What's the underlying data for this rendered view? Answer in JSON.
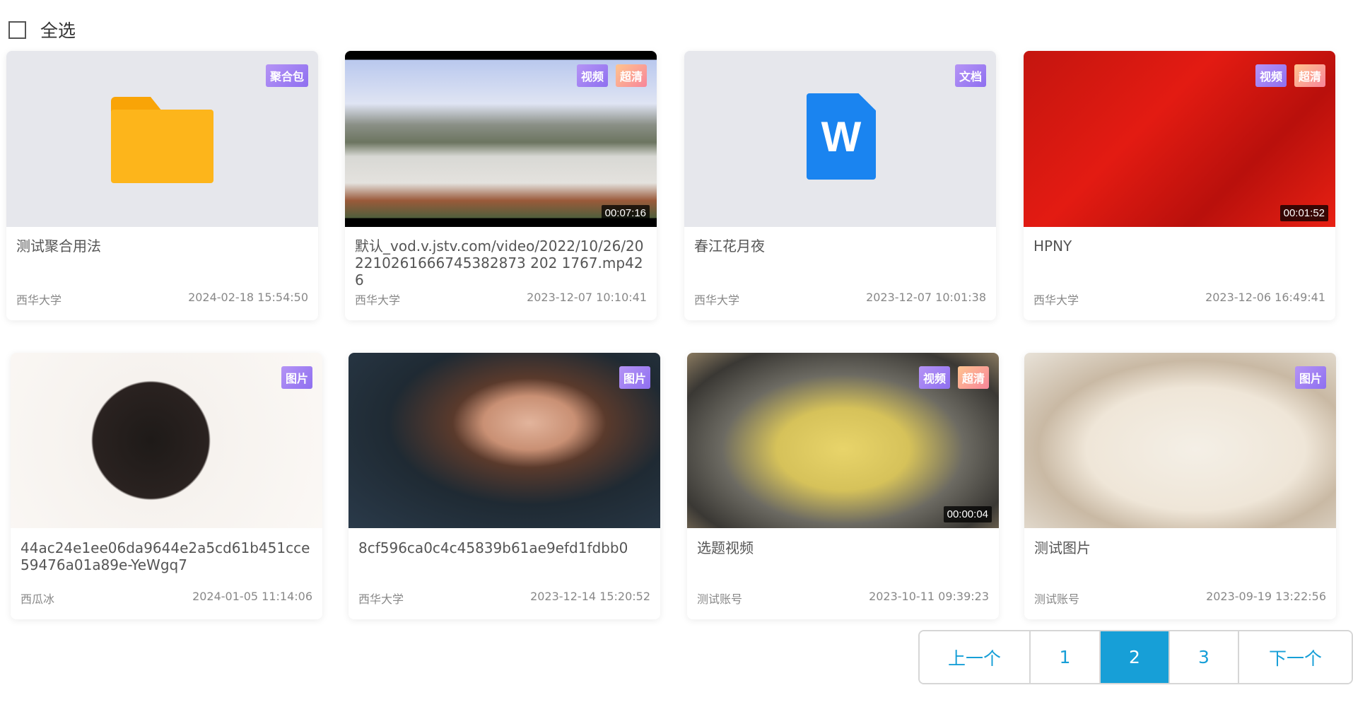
{
  "select_all": {
    "label": "全选",
    "checked": false
  },
  "cards": [
    {
      "type": "folder",
      "badges": [
        {
          "text": "聚合包",
          "color": "purple"
        }
      ],
      "duration": null,
      "title": "测试聚合用法",
      "owner": "西华大学",
      "time": "2024-02-18 15:54:50",
      "thumb": "#e6e7ec"
    },
    {
      "type": "video",
      "badges": [
        {
          "text": "视频",
          "color": "purple"
        },
        {
          "text": "超清",
          "color": "orange"
        }
      ],
      "duration": "00:07:16",
      "title": "默认_vod.v.jstv.com/video/2022/10/26/202210261666745382873 202 1767.mp426",
      "owner": "西华大学",
      "time": "2023-12-07 10:10:41",
      "thumb": "linear-gradient(180deg,#000 0,#000 5%,#b9c8ee 5%,#dfe4f3 30%,#8a8f86 42%,#6c7560 52%,#d8d8d4 60%,#e4e2de 75%,#9a5a3a 85%,#4f5f3c 95%,#000 95%)"
    },
    {
      "type": "document",
      "badges": [
        {
          "text": "文档",
          "color": "purple"
        }
      ],
      "duration": null,
      "title": "春江花月夜",
      "owner": "西华大学",
      "time": "2023-12-07 10:01:38",
      "thumb": "#e6e7ec"
    },
    {
      "type": "video",
      "badges": [
        {
          "text": "视频",
          "color": "purple"
        },
        {
          "text": "超清",
          "color": "orange"
        }
      ],
      "duration": "00:01:52",
      "title": "HPNY",
      "owner": "西华大学",
      "time": "2023-12-06 16:49:41",
      "thumb": "linear-gradient(135deg,#c4150f,#e31b12 40%,#b9100c 70%,#e82013)"
    },
    {
      "type": "image",
      "badges": [
        {
          "text": "图片",
          "color": "purple"
        }
      ],
      "duration": null,
      "title": "44ac24e1ee06da9644e2a5cd61b451cce59476a01a89e-YeWgq7",
      "owner": "西瓜冰",
      "time": "2024-01-05 11:14:06",
      "thumb": "radial-gradient(circle at 45% 50%,#1e1a18 0,#2a2220 30%,#f6f2ee 31%,#fbf8f5 100%)"
    },
    {
      "type": "image",
      "badges": [
        {
          "text": "图片",
          "color": "purple"
        }
      ],
      "duration": null,
      "title": "8cf596ca0c4c45839b61ae9efd1fdbb0",
      "owner": "西华大学",
      "time": "2023-12-14 15:20:52",
      "thumb": "radial-gradient(ellipse at 58% 40%,#e2b49c 0,#c99074 18%,#5a3a2c 30%,#1f2a33 55%,#2a3a4a 100%)"
    },
    {
      "type": "video",
      "badges": [
        {
          "text": "视频",
          "color": "purple"
        },
        {
          "text": "超清",
          "color": "orange"
        }
      ],
      "duration": "00:00:04",
      "title": "选题视频",
      "owner": "测试账号",
      "time": "2023-10-11 09:39:23",
      "thumb": "radial-gradient(ellipse at 50% 55%,#e8d46a 0,#d6c25a 30%,#6c6a62 55%,#3a3834 80%,#8a7a60 100%)"
    },
    {
      "type": "image",
      "badges": [
        {
          "text": "图片",
          "color": "purple"
        }
      ],
      "duration": null,
      "title": "测试图片",
      "owner": "测试账号",
      "time": "2023-09-19 13:22:56",
      "thumb": "radial-gradient(ellipse at 55% 55%,#f4efe6 0,#efe6d8 45%,#c9b9a4 65%,#e8e2d8 100%)"
    }
  ],
  "pagination": {
    "prev": "上一个",
    "pages": [
      "1",
      "2",
      "3"
    ],
    "current": "2",
    "next": "下一个",
    "accent": "#179fd7"
  }
}
